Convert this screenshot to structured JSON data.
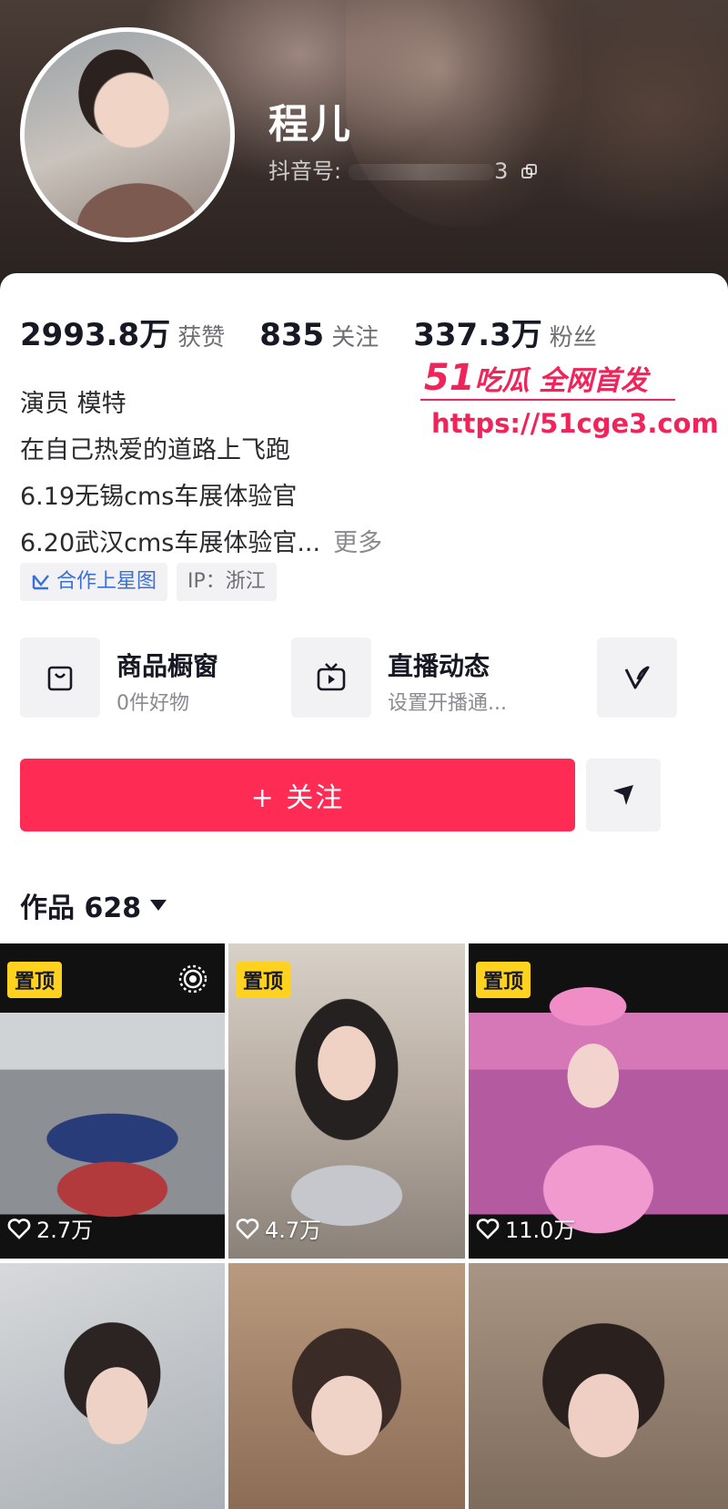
{
  "profile": {
    "nickname": "程儿",
    "douyin_id_label": "抖音号:",
    "douyin_id_tail": "3"
  },
  "stats": [
    {
      "num": "2993.8万",
      "label": "获赞"
    },
    {
      "num": "835",
      "label": "关注"
    },
    {
      "num": "337.3万",
      "label": "粉丝"
    }
  ],
  "bio": {
    "line1": "演员 模特",
    "line2": "在自己热爱的道路上飞跑",
    "line3": "6.19无锡cms车展体验官",
    "line4": "6.20武汉cms车展体验官...",
    "more": "更多"
  },
  "tags": {
    "cooperation": "合作上星图",
    "ip": "IP：浙江"
  },
  "shortcuts": {
    "shop_title": "商品橱窗",
    "shop_sub": "0件好物",
    "live_title": "直播动态",
    "live_sub": "设置开播通..."
  },
  "actions": {
    "follow": "+ 关注"
  },
  "works": {
    "label": "作品 628"
  },
  "grid": [
    {
      "pinned": "置顶",
      "likes": "2.7万"
    },
    {
      "pinned": "置顶",
      "likes": "4.7万"
    },
    {
      "pinned": "置顶",
      "likes": "11.0万"
    }
  ],
  "watermark": {
    "brand_num": "51",
    "brand_text": "吃瓜 全网首发",
    "url": "https://51cge3.com"
  },
  "colors": {
    "accent": "#fe2c55",
    "pin": "#ffd21f",
    "link": "#3b6fd8"
  }
}
